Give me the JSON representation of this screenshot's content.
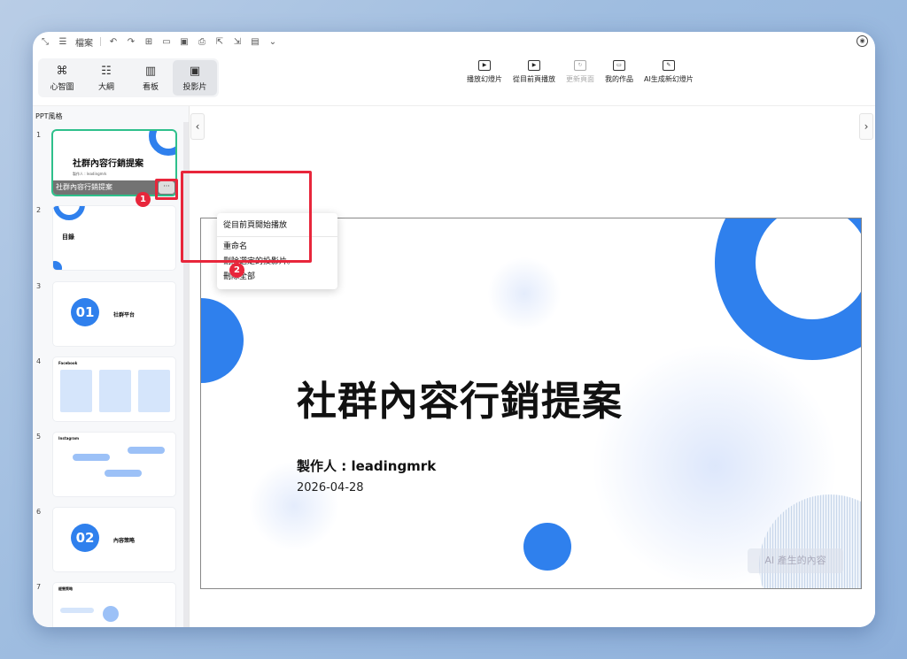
{
  "topbar": {
    "file_label": "檔案"
  },
  "views": [
    {
      "label": "心智圖",
      "icon": "mindmap-icon"
    },
    {
      "label": "大綱",
      "icon": "outline-icon"
    },
    {
      "label": "看板",
      "icon": "kanban-icon"
    },
    {
      "label": "投影片",
      "icon": "slides-icon"
    }
  ],
  "actions": [
    {
      "label": "播放幻燈片",
      "icon": "play-slideshow-icon"
    },
    {
      "label": "從目前頁播放",
      "icon": "play-from-current-icon"
    },
    {
      "label": "更新頁面",
      "icon": "refresh-page-icon"
    },
    {
      "label": "我的作品",
      "icon": "my-works-icon"
    },
    {
      "label": "AI生成新幻燈片",
      "icon": "ai-generate-icon"
    }
  ],
  "sidebar": {
    "heading": "PPT風格",
    "slides": [
      {
        "num": "1",
        "title": "社群內容行銷提案",
        "caption": "社群內容行銷提案"
      },
      {
        "num": "2",
        "title": "目錄"
      },
      {
        "num": "3",
        "badge": "01",
        "title": "社群平台"
      },
      {
        "num": "4",
        "title": "Facebook"
      },
      {
        "num": "5",
        "title": "Instagram"
      },
      {
        "num": "6",
        "badge": "02",
        "title": "內容策略"
      },
      {
        "num": "7",
        "title": "經營策略"
      }
    ]
  },
  "context_menu": {
    "items": [
      "從目前頁開始播放",
      "重命名",
      "刪除選定的投影片。",
      "刪除全部"
    ]
  },
  "steps": [
    "1",
    "2"
  ],
  "slide": {
    "title": "社群內容行銷提案",
    "author": "製作人 : leadingmrk",
    "date": "2026-04-28",
    "watermark": "AI 產生的內容"
  },
  "colors": {
    "accent": "#2f80ed",
    "selection": "#2ec08b",
    "highlight": "#e8263b"
  }
}
